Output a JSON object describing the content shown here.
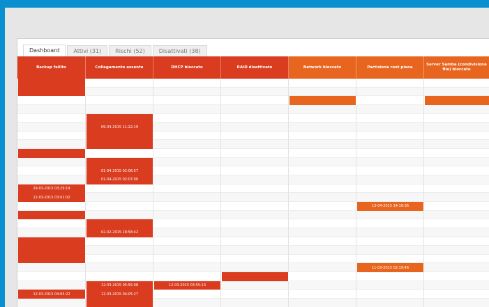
{
  "tabs": [
    "Dashboard",
    "Attivi (31)",
    "Rischi (52)",
    "Disattivati (38)"
  ],
  "columns": [
    {
      "label": "Backup fallito",
      "color": "#d93c1f"
    },
    {
      "label": "Collegamento assente",
      "color": "#d93c1f"
    },
    {
      "label": "DHCP bloccato",
      "color": "#d93c1f"
    },
    {
      "label": "RAID disattivato",
      "color": "#d93c1f"
    },
    {
      "label": "Network bloccato",
      "color": "#e8651f"
    },
    {
      "label": "Partizione root piena",
      "color": "#e8651f"
    },
    {
      "label": "Server Samba (condivisione file) bloccato",
      "color": "#e8651f"
    }
  ],
  "rows": [
    [
      {
        "f": 1
      },
      {},
      {},
      {},
      {},
      {},
      {}
    ],
    [
      {
        "f": 1
      },
      {},
      {},
      {},
      {},
      {},
      {}
    ],
    [
      {},
      {},
      {},
      {},
      {
        "f": 1
      },
      {},
      {
        "f": 1
      }
    ],
    [
      {},
      {},
      {},
      {},
      {},
      {},
      {}
    ],
    [
      {},
      {
        "f": 1
      },
      {},
      {},
      {},
      {},
      {}
    ],
    [
      {},
      {
        "f": 1,
        "t": "09-04-2015 11:22:19"
      },
      {},
      {},
      {},
      {},
      {}
    ],
    [
      {},
      {
        "f": 1
      },
      {},
      {},
      {},
      {},
      {}
    ],
    [
      {},
      {
        "f": 1
      },
      {},
      {},
      {},
      {},
      {}
    ],
    [
      {
        "f": 1
      },
      {},
      {},
      {},
      {},
      {},
      {}
    ],
    [
      {},
      {
        "f": 1
      },
      {},
      {},
      {},
      {},
      {}
    ],
    [
      {},
      {
        "f": 1,
        "t": "01-04-2015 02:06:57"
      },
      {},
      {},
      {},
      {},
      {}
    ],
    [
      {},
      {
        "f": 1,
        "t": "01-04-2015 02:07:00"
      },
      {},
      {},
      {},
      {},
      {}
    ],
    [
      {
        "f": 1,
        "t": "29-03-2015 03:29:19"
      },
      {},
      {},
      {},
      {},
      {},
      {}
    ],
    [
      {
        "f": 1,
        "t": "12-03-2015 03:01:02"
      },
      {},
      {},
      {},
      {},
      {},
      {}
    ],
    [
      {},
      {},
      {},
      {},
      {},
      {
        "f": 1,
        "t": "13-04-2015 14:16:36"
      },
      {}
    ],
    [
      {
        "f": 1
      },
      {},
      {},
      {},
      {},
      {},
      {}
    ],
    [
      {},
      {
        "f": 1
      },
      {},
      {},
      {},
      {},
      {}
    ],
    [
      {},
      {
        "f": 1,
        "t": "02-02-2015 18:58:42"
      },
      {},
      {},
      {},
      {},
      {}
    ],
    [
      {
        "f": 1
      },
      {},
      {},
      {},
      {},
      {},
      {}
    ],
    [
      {
        "f": 1
      },
      {},
      {},
      {},
      {},
      {},
      {}
    ],
    [
      {
        "f": 1
      },
      {},
      {},
      {},
      {},
      {},
      {}
    ],
    [
      {},
      {},
      {},
      {},
      {},
      {
        "f": 1,
        "t": "11-03-2015 02:19:46"
      },
      {}
    ],
    [
      {},
      {},
      {},
      {
        "f": 1
      },
      {},
      {},
      {}
    ],
    [
      {},
      {
        "f": 1,
        "t": "12-03-2015 05:55:08"
      },
      {
        "f": 1,
        "t": "12-03-2015 03:55:13"
      },
      {},
      {},
      {},
      {}
    ],
    [
      {
        "f": 1,
        "t": "12-03-2015 04:05:22"
      },
      {
        "f": 1,
        "t": "12-03-2015 04:05:27"
      },
      {},
      {},
      {},
      {},
      {}
    ],
    [
      {},
      {
        "f": 1
      },
      {},
      {},
      {},
      {},
      {}
    ]
  ]
}
